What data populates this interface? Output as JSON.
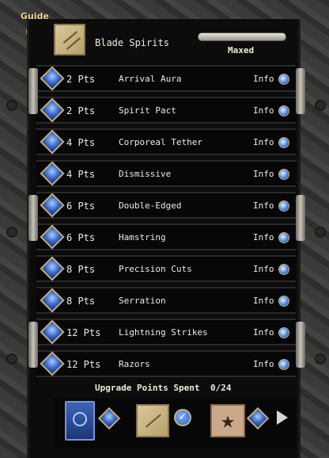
{
  "guide": {
    "label": "Guide"
  },
  "header": {
    "spell_name": "Blade Spirits",
    "status": "Maxed",
    "progress": 1.0
  },
  "upgrades": [
    {
      "pts": "2 Pts",
      "title": "Arrival Aura",
      "info": "Info"
    },
    {
      "pts": "2 Pts",
      "title": "Spirit Pact",
      "info": "Info"
    },
    {
      "pts": "4 Pts",
      "title": "Corporeal Tether",
      "info": "Info"
    },
    {
      "pts": "4 Pts",
      "title": "Dismissive",
      "info": "Info"
    },
    {
      "pts": "6 Pts",
      "title": "Double-Edged",
      "info": "Info"
    },
    {
      "pts": "6 Pts",
      "title": "Hamstring",
      "info": "Info"
    },
    {
      "pts": "8 Pts",
      "title": "Precision Cuts",
      "info": "Info"
    },
    {
      "pts": "8 Pts",
      "title": "Serration",
      "info": "Info"
    },
    {
      "pts": "12 Pts",
      "title": "Lightning Strikes",
      "info": "Info"
    },
    {
      "pts": "12 Pts",
      "title": "Razors",
      "info": "Info"
    }
  ],
  "footer": {
    "spent_label": "Upgrade Points Spent",
    "spent_value": "0/24"
  },
  "icons": {
    "gem": "blue-gem-icon",
    "info": "info-orb-icon",
    "spellbook": "spellbook-icon",
    "scroll": "spell-scroll-icon",
    "pentagram": "pentagram-icon",
    "check": "checkmark-icon",
    "next": "next-arrow-icon"
  },
  "colors": {
    "panel": "#0c0c0c",
    "text": "#f0ead8",
    "gem": "#3566c8",
    "gold": "#c9b07a"
  }
}
